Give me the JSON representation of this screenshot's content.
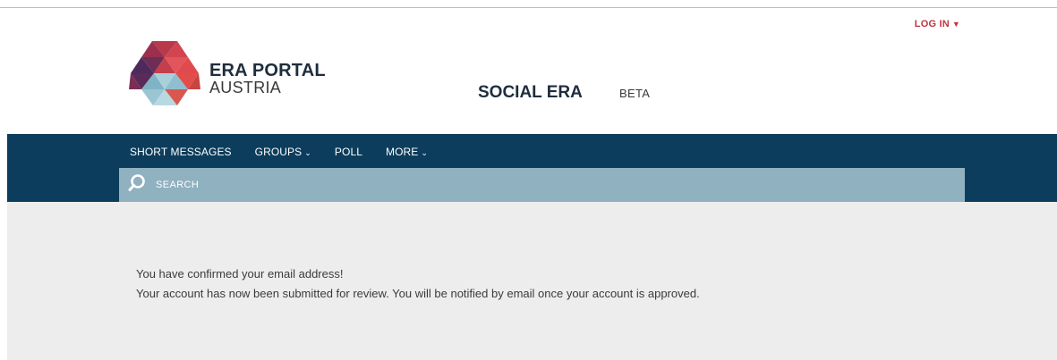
{
  "header": {
    "login_label": "LOG IN",
    "login_caret": "▼",
    "brand_line1": "ERA PORTAL",
    "brand_line2": "AUSTRIA",
    "site_title": "SOCIAL ERA",
    "site_tag": "BETA"
  },
  "nav": {
    "items": [
      {
        "label": "SHORT MESSAGES",
        "dropdown": ""
      },
      {
        "label": "GROUPS",
        "dropdown": "⌄"
      },
      {
        "label": "POLL",
        "dropdown": ""
      },
      {
        "label": "MORE",
        "dropdown": "⌄"
      }
    ]
  },
  "search": {
    "placeholder": "SEARCH"
  },
  "content": {
    "line1": "You have confirmed your email address!",
    "line2": "Your account has now been submitted for review. You will be notified by email once your account is approved."
  },
  "colors": {
    "nav_bg": "#0c3d5c",
    "search_bg": "#8fb1c0",
    "content_bg": "#ededed",
    "accent_red": "#c0353d"
  },
  "icons": {
    "logo": "triangle-mosaic-logo",
    "search": "search-icon"
  }
}
